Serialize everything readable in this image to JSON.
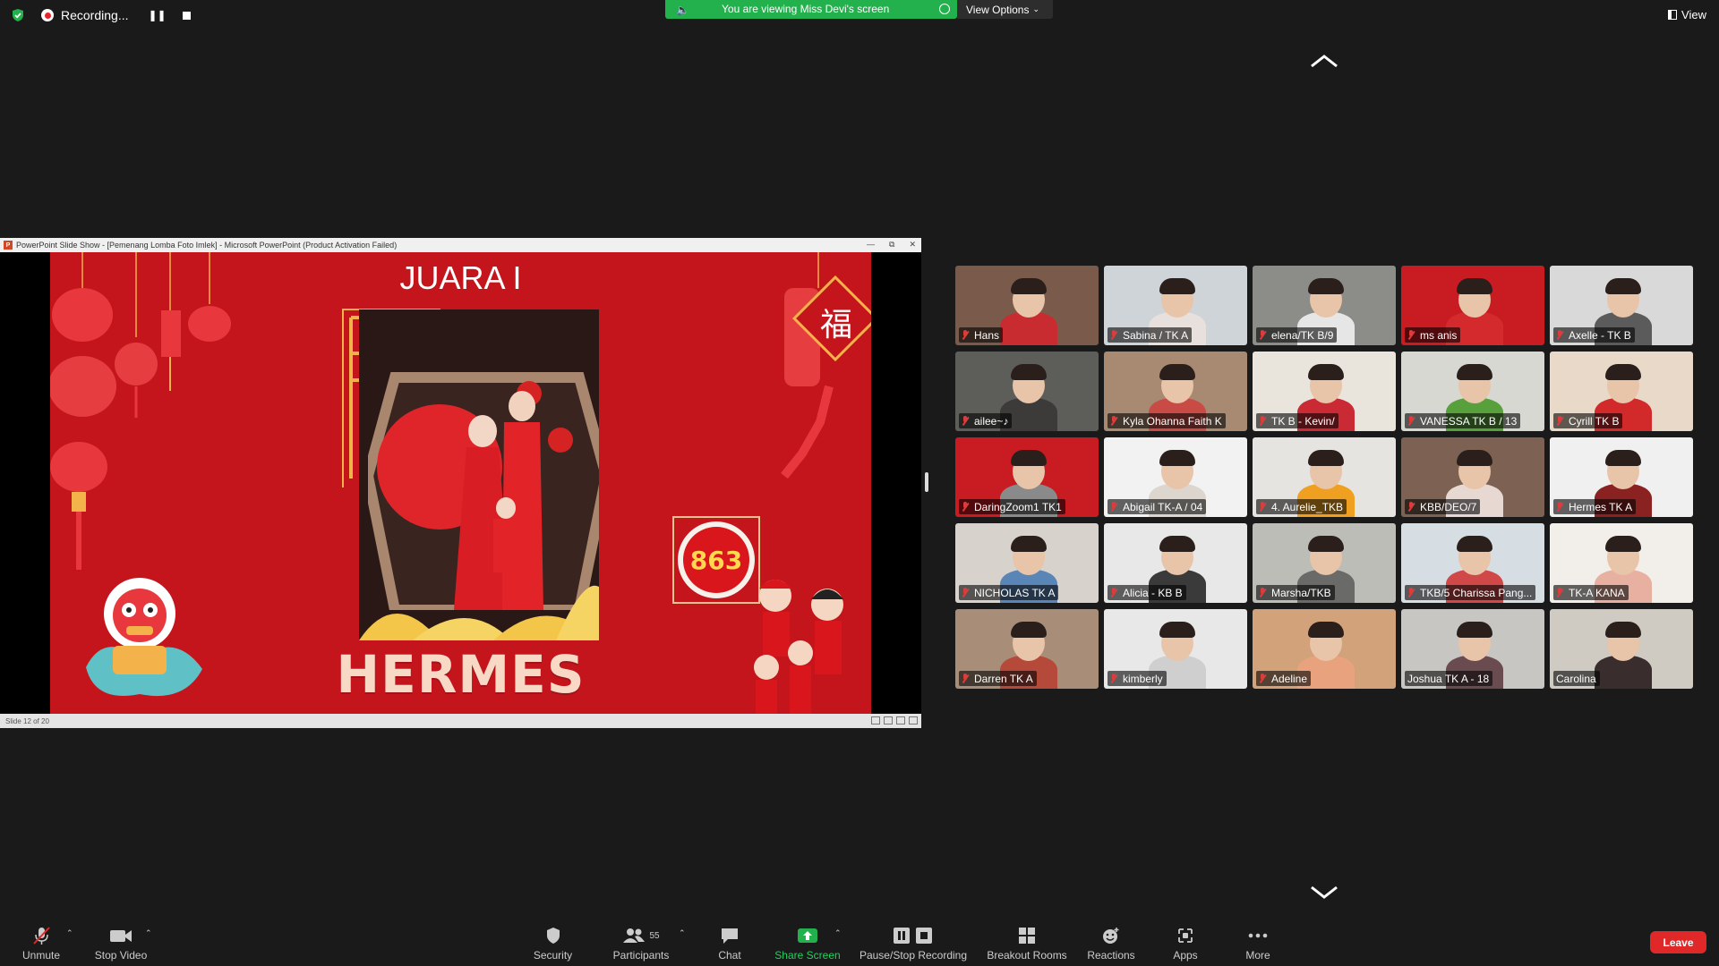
{
  "topbar": {
    "recording_label": "Recording...",
    "banner_text": "You are viewing Miss Devi's screen",
    "view_options_label": "View Options",
    "view_label": "View"
  },
  "ppt": {
    "window_title": "PowerPoint Slide Show - [Pemenang Lomba Foto Imlek] - Microsoft PowerPoint (Product Activation Failed)",
    "status_text": "Slide 12 of 20"
  },
  "slide": {
    "heading": "JUARA I",
    "winner_name": "HERMES",
    "score": "863",
    "fu_character": "福",
    "colors": {
      "background": "#c3151b",
      "gold": "#f3b24a"
    }
  },
  "participants": [
    {
      "name": "Hans",
      "muted": true,
      "bg": "#7a5a4a",
      "shirt": "#c82b30"
    },
    {
      "name": "Sabina / TK A",
      "muted": true,
      "bg": "#cfd4d8",
      "shirt": "#e8e0dc"
    },
    {
      "name": "elena/TK B/9",
      "muted": true,
      "bg": "#8c8c88",
      "shirt": "#e6e6e6"
    },
    {
      "name": "ms anis",
      "muted": true,
      "bg": "#c91b22",
      "shirt": "#d42a2e"
    },
    {
      "name": "Axelle - TK B",
      "muted": true,
      "bg": "#d9d9d9",
      "shirt": "#5b5b5b"
    },
    {
      "name": "ailee~♪",
      "muted": true,
      "bg": "#5d5d5a",
      "shirt": "#3d3a3a"
    },
    {
      "name": "Kyla Ohanna Faith K",
      "muted": true,
      "bg": "#a88a72",
      "shirt": "#c94b45"
    },
    {
      "name": "TK B - Kevin/",
      "muted": true,
      "bg": "#e9e4dc",
      "shirt": "#c92a33"
    },
    {
      "name": "VANESSA TK B / 13",
      "muted": true,
      "bg": "#d7d8d2",
      "shirt": "#58a03b"
    },
    {
      "name": "Cyrill TK B",
      "muted": true,
      "bg": "#e8d9c8",
      "shirt": "#d22a2a"
    },
    {
      "name": "DaringZoom1 TK1",
      "muted": true,
      "bg": "#c91b22",
      "shirt": "#8a8a8a"
    },
    {
      "name": "Abigail TK-A / 04",
      "muted": true,
      "bg": "#f2f2f2",
      "shirt": "#ddd6cf"
    },
    {
      "name": "4. Aurelie_TKB",
      "muted": true,
      "bg": "#e6e4e0",
      "shirt": "#f0a020"
    },
    {
      "name": "KBB/DEO/7",
      "muted": true,
      "bg": "#7d6152",
      "shirt": "#e7d8d2"
    },
    {
      "name": "Hermes TK A",
      "muted": true,
      "bg": "#f0f0f0",
      "shirt": "#8b2222"
    },
    {
      "name": "NICHOLAS TK A",
      "muted": true,
      "bg": "#d8d2cc",
      "shirt": "#5a86b7"
    },
    {
      "name": "Alicia - KB B",
      "muted": true,
      "bg": "#e8e8e8",
      "shirt": "#3a3a3a"
    },
    {
      "name": "Marsha/TKB",
      "muted": true,
      "bg": "#bdbdb8",
      "shirt": "#6a6a68"
    },
    {
      "name": "TKB/5 Charissa Pang...",
      "muted": true,
      "bg": "#d6dde3",
      "shirt": "#d04848"
    },
    {
      "name": "TK-A KANA",
      "muted": true,
      "bg": "#f2eeea",
      "shirt": "#e8b0a0"
    },
    {
      "name": "Darren TK A",
      "muted": true,
      "bg": "#a88e78",
      "shirt": "#b64a3a"
    },
    {
      "name": "kimberly",
      "muted": true,
      "bg": "#e8e8e8",
      "shirt": "#cfcfcf"
    },
    {
      "name": "Adeline",
      "muted": true,
      "bg": "#d2a27a",
      "shirt": "#e8a27e"
    },
    {
      "name": "Joshua TK A - 18",
      "muted": false,
      "bg": "#c8c6c2",
      "shirt": "#6a4b50"
    },
    {
      "name": "Carolina",
      "muted": false,
      "bg": "#cfcac2",
      "shirt": "#3a2d2d"
    }
  ],
  "toolbar": {
    "unmute": "Unmute",
    "stop_video": "Stop Video",
    "security": "Security",
    "participants": "Participants",
    "participant_count": "55",
    "chat": "Chat",
    "share_screen": "Share Screen",
    "pause_stop_recording": "Pause/Stop Recording",
    "breakout_rooms": "Breakout Rooms",
    "reactions": "Reactions",
    "apps": "Apps",
    "more": "More",
    "leave": "Leave"
  }
}
